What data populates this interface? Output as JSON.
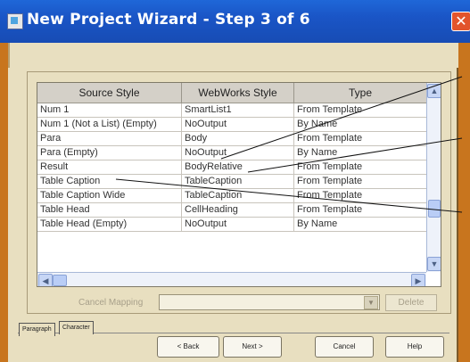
{
  "window": {
    "title": "New Project Wizard - Step 3 of 6",
    "close_glyph": "✕"
  },
  "grid": {
    "columns": [
      "Source Style",
      "WebWorks Style",
      "Type"
    ],
    "rows": [
      [
        "Num 1",
        "SmartList1",
        "From Template"
      ],
      [
        "Num 1 (Not a List) (Empty)",
        "NoOutput",
        "By Name"
      ],
      [
        "Para",
        "Body",
        "From Template"
      ],
      [
        "Para (Empty)",
        "NoOutput",
        "By Name"
      ],
      [
        "Result",
        "BodyRelative",
        "From Template"
      ],
      [
        "Table Caption",
        "TableCaption",
        "From Template"
      ],
      [
        "Table Caption Wide",
        "TableCaption",
        "From Template"
      ],
      [
        "Table Head",
        "CellHeading",
        "From Template"
      ],
      [
        "Table Head (Empty)",
        "NoOutput",
        "By Name"
      ]
    ]
  },
  "mapping": {
    "label": "Cancel Mapping",
    "value": "",
    "delete_label": "Delete"
  },
  "tabs": [
    {
      "label": "Paragraph",
      "active": true
    },
    {
      "label": "Character",
      "active": false
    }
  ],
  "buttons": {
    "back": "< Back",
    "next": "Next >",
    "cancel": "Cancel",
    "help": "Help"
  },
  "icons": {
    "up": "up-arrow-icon",
    "down": "down-arrow-icon",
    "left": "left-arrow-icon",
    "right": "right-arrow-icon",
    "dropdown": "chevron-down-icon"
  },
  "colors": {
    "desktop": "#c8751e",
    "titlebar": "#1a55c6",
    "close": "#e2542c",
    "dialog": "#e8dfc0"
  }
}
